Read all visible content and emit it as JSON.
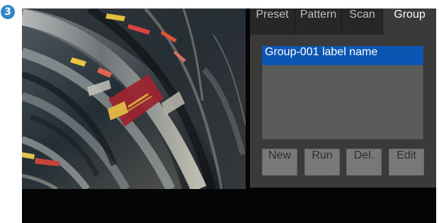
{
  "step_badge": "3",
  "tabs": [
    {
      "label": "Preset"
    },
    {
      "label": "Pattern"
    },
    {
      "label": "Scan"
    },
    {
      "label": "Group"
    }
  ],
  "active_tab": "Group",
  "group_list": {
    "items": [
      {
        "label": "Group-001 label name",
        "selected": true
      }
    ]
  },
  "buttons": {
    "new": "New",
    "run": "Run",
    "delete": "Del.",
    "edit": "Edit"
  },
  "colors": {
    "badge": "#2f87c8",
    "selection": "#0c56b3",
    "panel": "#3a3a3a",
    "tab_bar": "#272727",
    "list_background": "#5b5b5b",
    "button": "#787878"
  }
}
